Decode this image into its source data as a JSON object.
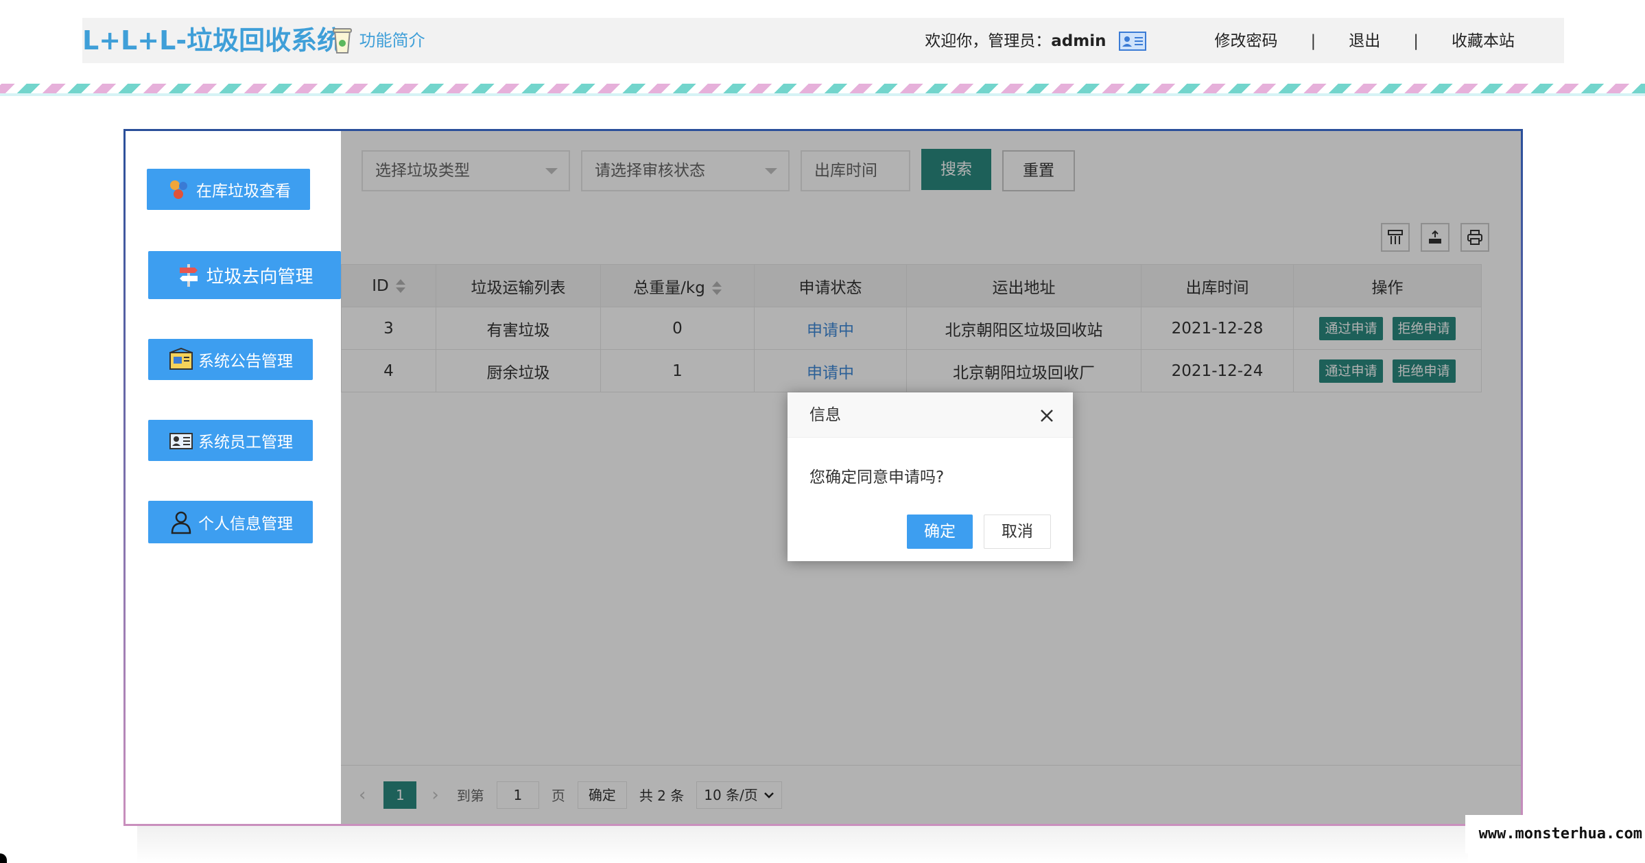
{
  "header": {
    "logo": "L+L+L-垃圾回收系统",
    "intro": "功能简介",
    "welcome_prefix": "欢迎你，管理员：",
    "username": "admin",
    "change_password": "修改密码",
    "logout": "退出",
    "bookmark": "收藏本站",
    "separator": "|"
  },
  "sidebar": {
    "items": [
      {
        "label": "在库垃圾查看",
        "icon": "recycle-icon"
      },
      {
        "label": "垃圾去向管理",
        "icon": "signpost-icon",
        "active": true
      },
      {
        "label": "系统公告管理",
        "icon": "notice-board-icon"
      },
      {
        "label": "系统员工管理",
        "icon": "id-card-icon"
      },
      {
        "label": "个人信息管理",
        "icon": "user-icon"
      }
    ]
  },
  "filters": {
    "trash_type": "选择垃圾类型",
    "review_status": "请选择审核状态",
    "out_time": "出库时间",
    "search": "搜索",
    "reset": "重置"
  },
  "table": {
    "columns": [
      "ID",
      "垃圾运输列表",
      "总重量/kg",
      "申请状态",
      "运出地址",
      "出库时间",
      "操作"
    ],
    "rows": [
      {
        "id": "3",
        "type": "有害垃圾",
        "weight": "0",
        "status": "申请中",
        "address": "北京朝阳区垃圾回收站",
        "date": "2021-12-28"
      },
      {
        "id": "4",
        "type": "厨余垃圾",
        "weight": "1",
        "status": "申请中",
        "address": "北京朝阳垃圾回收厂",
        "date": "2021-12-24"
      }
    ],
    "approve": "通过申请",
    "reject": "拒绝申请"
  },
  "pager": {
    "current": "1",
    "goto_label": "到第",
    "goto_value": "1",
    "page_unit": "页",
    "confirm": "确定",
    "total": "共 2 条",
    "page_size": "10 条/页"
  },
  "dialog": {
    "title": "信息",
    "message": "您确定同意申请吗?",
    "ok": "确定",
    "cancel": "取消"
  },
  "watermark": "www.monsterhua.com",
  "colors": {
    "brand_blue": "#3f9fd8",
    "sidebar_button": "#3d9ef0",
    "teal": "#2a8a80",
    "status_link": "#3f8ad8"
  }
}
